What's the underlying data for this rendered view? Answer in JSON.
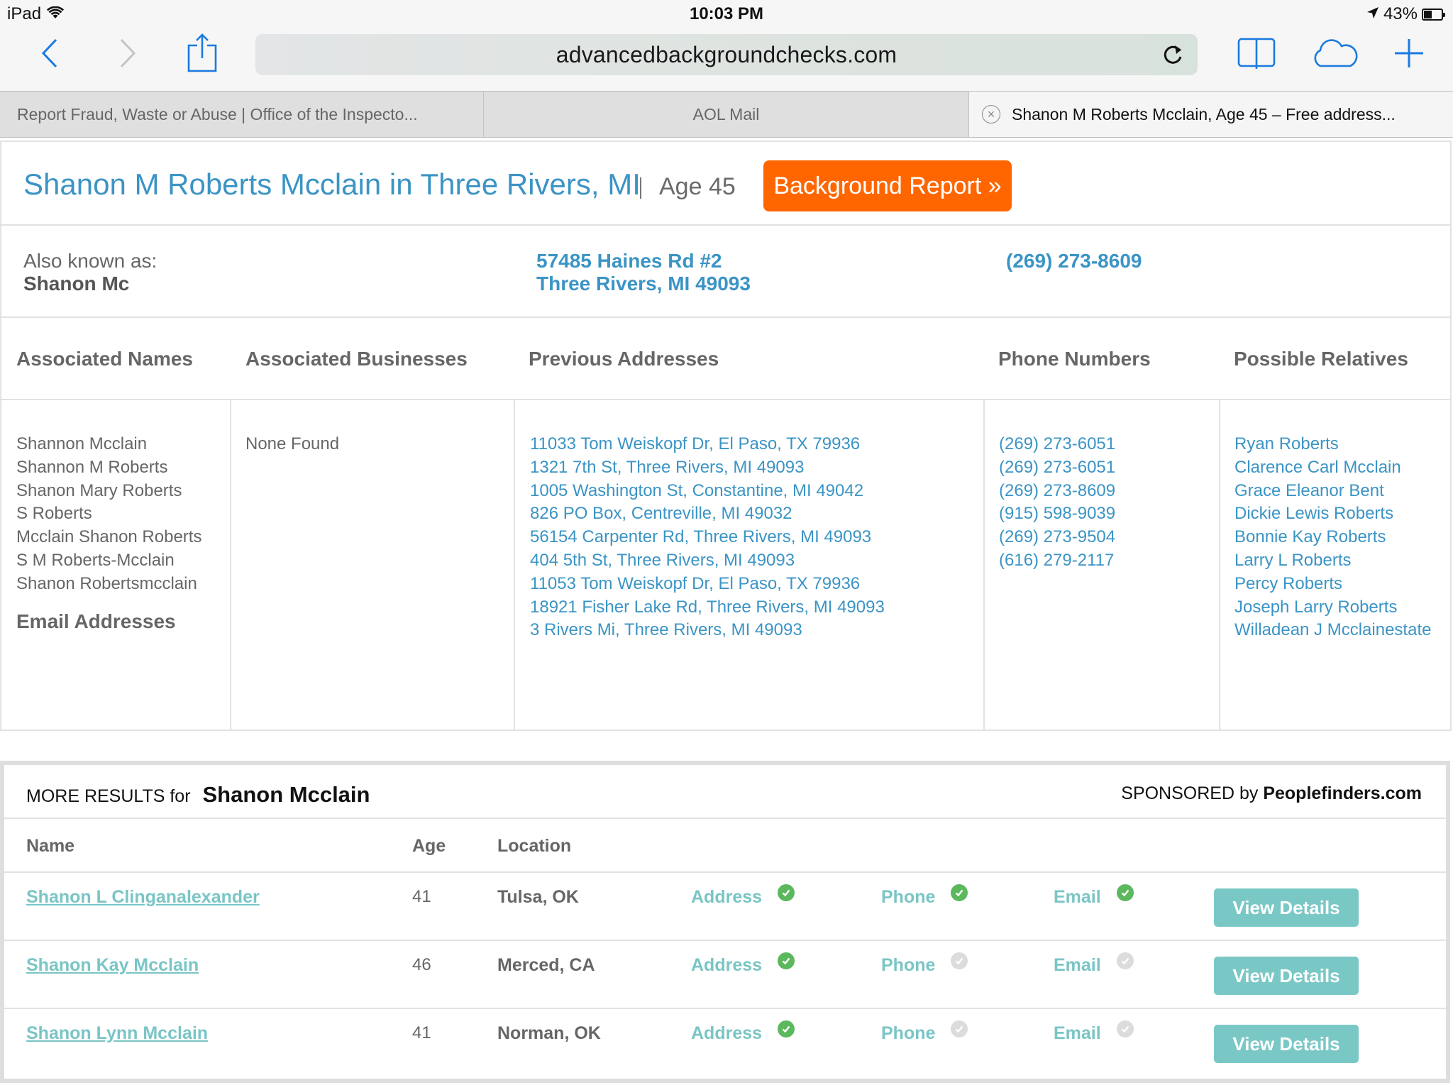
{
  "status_bar": {
    "device": "iPad",
    "time": "10:03 PM",
    "battery": "43%",
    "battery_level": 0.43
  },
  "browser": {
    "url": "advancedbackgroundchecks.com",
    "icons": {
      "back": "chevron-left-icon",
      "forward": "chevron-right-icon",
      "share": "share-icon",
      "reload": "reload-icon",
      "bookmarks": "book-icon",
      "icloud_tabs": "cloud-icon",
      "new_tab": "plus-icon"
    },
    "tabs": [
      {
        "label": "Report Fraud, Waste or Abuse | Office of the Inspecto...",
        "active": false
      },
      {
        "label": "AOL Mail",
        "active": false
      },
      {
        "label": "Shanon M Roberts Mcclain, Age 45 – Free address...",
        "active": true
      }
    ]
  },
  "profile": {
    "title": "Shanon M Roberts Mcclain in Three Rivers, MI",
    "age": "Age 45",
    "report_button": "Background Report »",
    "aka_label": "Also known as:",
    "aka_name": "Shanon Mc",
    "current_address_line1": "57485 Haines Rd #2",
    "current_address_line2": "Three Rivers, MI 49093",
    "current_phone": "(269) 273-8609"
  },
  "details": {
    "headers": {
      "names": "Associated Names",
      "businesses": "Associated Businesses",
      "addresses": "Previous Addresses",
      "phones": "Phone Numbers",
      "relatives": "Possible Relatives"
    },
    "associated_names": [
      "Shannon Mcclain",
      "Shannon M Roberts",
      "Shanon Mary Roberts",
      "S Roberts",
      "Mcclain Shanon Roberts",
      "S M Roberts-Mcclain",
      "Shanon Robertsmcclain"
    ],
    "email_header": "Email Addresses",
    "associated_businesses": [
      "None Found"
    ],
    "previous_addresses": [
      "11033 Tom Weiskopf Dr, El Paso, TX 79936",
      "1321 7th St, Three Rivers, MI 49093",
      "1005 Washington St, Constantine, MI 49042",
      "826 PO Box, Centreville, MI 49032",
      "56154 Carpenter Rd, Three Rivers, MI 49093",
      "404 5th St, Three Rivers, MI 49093",
      "11053 Tom Weiskopf Dr, El Paso, TX 79936",
      "18921 Fisher Lake Rd, Three Rivers, MI 49093",
      "3 Rivers Mi, Three Rivers, MI 49093"
    ],
    "phone_numbers": [
      "(269) 273-6051",
      "(269) 273-6051",
      "(269) 273-8609",
      "(915) 598-9039",
      "(269) 273-9504",
      "(616) 279-2117"
    ],
    "possible_relatives": [
      "Ryan Roberts",
      "Clarence Carl Mcclain",
      "Grace Eleanor Bent",
      "Dickie Lewis Roberts",
      "Bonnie Kay Roberts",
      "Larry L Roberts",
      "Percy Roberts",
      "Joseph Larry Roberts",
      "Willadean J Mcclainestate"
    ]
  },
  "more_results": {
    "prefix": "MORE RESULTS for",
    "query": "Shanon Mcclain",
    "sponsored_prefix": "SPONSORED by",
    "sponsor": "Peoplefinders.com",
    "columns": {
      "name": "Name",
      "age": "Age",
      "location": "Location"
    },
    "flag_labels": {
      "address": "Address",
      "phone": "Phone",
      "email": "Email"
    },
    "button_label": "View Details",
    "rows": [
      {
        "name": "Shanon L Clinganalexander",
        "age": "41",
        "location": "Tulsa, OK",
        "address": true,
        "phone": true,
        "email": true
      },
      {
        "name": "Shanon Kay Mcclain",
        "age": "46",
        "location": "Merced, CA",
        "address": true,
        "phone": false,
        "email": false
      },
      {
        "name": "Shanon Lynn Mcclain",
        "age": "41",
        "location": "Norman, OK",
        "address": true,
        "phone": false,
        "email": false
      }
    ]
  },
  "colors": {
    "link_blue": "#3b94c5",
    "accent_orange": "#ff6600",
    "teal": "#7ac5c5",
    "check_green": "#5cb85c",
    "check_gray": "#dcdcdc",
    "ios_blue": "#1a7ae0"
  }
}
